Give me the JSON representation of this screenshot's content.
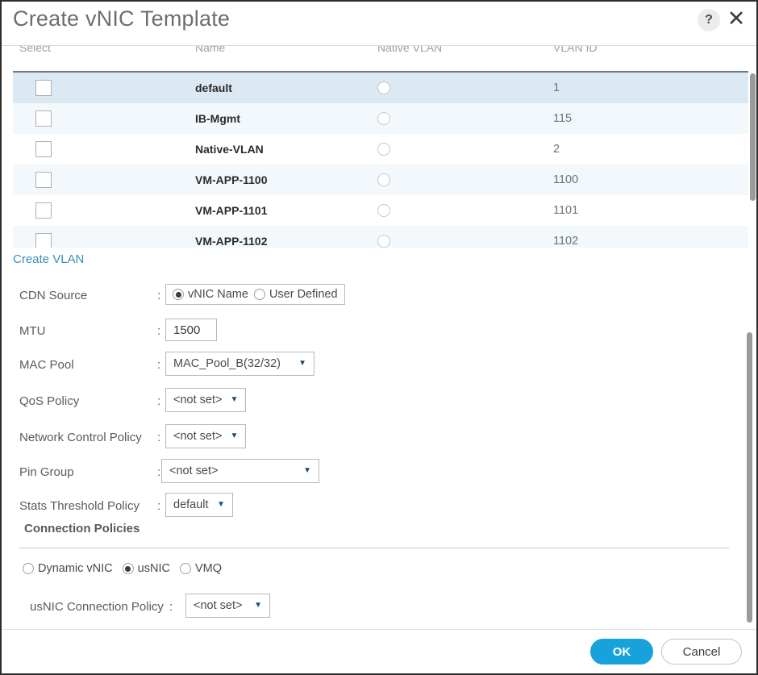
{
  "header": {
    "title": "Create vNIC Template",
    "help_icon": "question-mark-icon",
    "close_icon": "close-icon"
  },
  "vlan_table": {
    "columns": [
      "Select",
      "Name",
      "Native VLAN",
      "VLAN ID"
    ],
    "rows": [
      {
        "name": "default",
        "vlan_id": "1",
        "selected": false,
        "native": false
      },
      {
        "name": "IB-Mgmt",
        "vlan_id": "115",
        "selected": false,
        "native": false
      },
      {
        "name": "Native-VLAN",
        "vlan_id": "2",
        "selected": false,
        "native": false
      },
      {
        "name": "VM-APP-1100",
        "vlan_id": "1100",
        "selected": false,
        "native": false
      },
      {
        "name": "VM-APP-1101",
        "vlan_id": "1101",
        "selected": false,
        "native": false
      },
      {
        "name": "VM-APP-1102",
        "vlan_id": "1102",
        "selected": false,
        "native": false
      }
    ]
  },
  "form": {
    "create_vlan_link": "Create VLAN",
    "colon": ":",
    "cdn_source": {
      "label": "CDN Source",
      "options": [
        "vNIC Name",
        "User Defined"
      ],
      "selected": "vNIC Name"
    },
    "mtu": {
      "label": "MTU",
      "value": "1500"
    },
    "mac_pool": {
      "label": "MAC Pool",
      "value": "MAC_Pool_B(32/32)"
    },
    "qos_policy": {
      "label": "QoS Policy",
      "value": "<not set>"
    },
    "network_control_policy": {
      "label": "Network Control Policy",
      "value": "<not set>"
    },
    "pin_group": {
      "label": "Pin Group",
      "value": "<not set>"
    },
    "stats_threshold_policy": {
      "label": "Stats Threshold Policy",
      "value": "default"
    }
  },
  "connection_policies": {
    "title": "Connection Policies",
    "options": [
      "Dynamic vNIC",
      "usNIC",
      "VMQ"
    ],
    "selected": "usNIC",
    "usnic_connection_policy": {
      "label": "usNIC Connection Policy",
      "value": "<not set>"
    }
  },
  "footer": {
    "ok_label": "OK",
    "cancel_label": "Cancel"
  },
  "colors": {
    "accent_blue": "#17a2dc",
    "link_blue": "#3c8dbc",
    "row_selected": "#dce9f3",
    "row_alt": "#f2f8fb"
  }
}
